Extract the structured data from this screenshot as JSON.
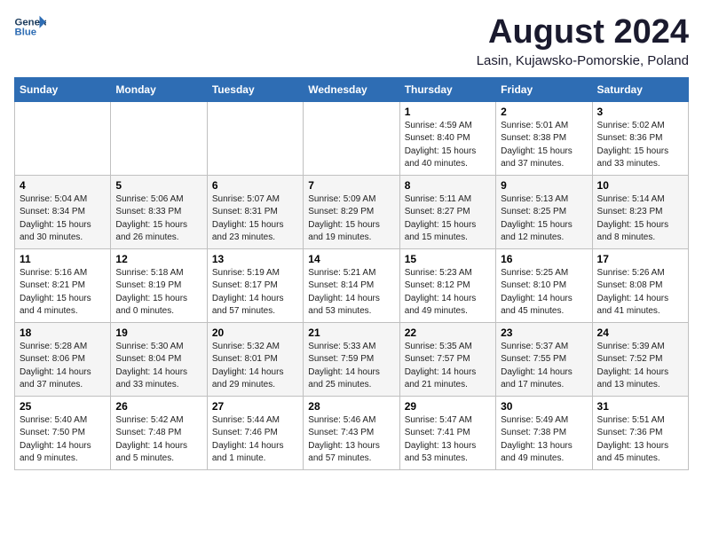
{
  "logo": {
    "line1": "General",
    "line2": "Blue"
  },
  "title": "August 2024",
  "location": "Lasin, Kujawsko-Pomorskie, Poland",
  "days_of_week": [
    "Sunday",
    "Monday",
    "Tuesday",
    "Wednesday",
    "Thursday",
    "Friday",
    "Saturday"
  ],
  "weeks": [
    [
      {
        "num": "",
        "info": ""
      },
      {
        "num": "",
        "info": ""
      },
      {
        "num": "",
        "info": ""
      },
      {
        "num": "",
        "info": ""
      },
      {
        "num": "1",
        "info": "Sunrise: 4:59 AM\nSunset: 8:40 PM\nDaylight: 15 hours\nand 40 minutes."
      },
      {
        "num": "2",
        "info": "Sunrise: 5:01 AM\nSunset: 8:38 PM\nDaylight: 15 hours\nand 37 minutes."
      },
      {
        "num": "3",
        "info": "Sunrise: 5:02 AM\nSunset: 8:36 PM\nDaylight: 15 hours\nand 33 minutes."
      }
    ],
    [
      {
        "num": "4",
        "info": "Sunrise: 5:04 AM\nSunset: 8:34 PM\nDaylight: 15 hours\nand 30 minutes."
      },
      {
        "num": "5",
        "info": "Sunrise: 5:06 AM\nSunset: 8:33 PM\nDaylight: 15 hours\nand 26 minutes."
      },
      {
        "num": "6",
        "info": "Sunrise: 5:07 AM\nSunset: 8:31 PM\nDaylight: 15 hours\nand 23 minutes."
      },
      {
        "num": "7",
        "info": "Sunrise: 5:09 AM\nSunset: 8:29 PM\nDaylight: 15 hours\nand 19 minutes."
      },
      {
        "num": "8",
        "info": "Sunrise: 5:11 AM\nSunset: 8:27 PM\nDaylight: 15 hours\nand 15 minutes."
      },
      {
        "num": "9",
        "info": "Sunrise: 5:13 AM\nSunset: 8:25 PM\nDaylight: 15 hours\nand 12 minutes."
      },
      {
        "num": "10",
        "info": "Sunrise: 5:14 AM\nSunset: 8:23 PM\nDaylight: 15 hours\nand 8 minutes."
      }
    ],
    [
      {
        "num": "11",
        "info": "Sunrise: 5:16 AM\nSunset: 8:21 PM\nDaylight: 15 hours\nand 4 minutes."
      },
      {
        "num": "12",
        "info": "Sunrise: 5:18 AM\nSunset: 8:19 PM\nDaylight: 15 hours\nand 0 minutes."
      },
      {
        "num": "13",
        "info": "Sunrise: 5:19 AM\nSunset: 8:17 PM\nDaylight: 14 hours\nand 57 minutes."
      },
      {
        "num": "14",
        "info": "Sunrise: 5:21 AM\nSunset: 8:14 PM\nDaylight: 14 hours\nand 53 minutes."
      },
      {
        "num": "15",
        "info": "Sunrise: 5:23 AM\nSunset: 8:12 PM\nDaylight: 14 hours\nand 49 minutes."
      },
      {
        "num": "16",
        "info": "Sunrise: 5:25 AM\nSunset: 8:10 PM\nDaylight: 14 hours\nand 45 minutes."
      },
      {
        "num": "17",
        "info": "Sunrise: 5:26 AM\nSunset: 8:08 PM\nDaylight: 14 hours\nand 41 minutes."
      }
    ],
    [
      {
        "num": "18",
        "info": "Sunrise: 5:28 AM\nSunset: 8:06 PM\nDaylight: 14 hours\nand 37 minutes."
      },
      {
        "num": "19",
        "info": "Sunrise: 5:30 AM\nSunset: 8:04 PM\nDaylight: 14 hours\nand 33 minutes."
      },
      {
        "num": "20",
        "info": "Sunrise: 5:32 AM\nSunset: 8:01 PM\nDaylight: 14 hours\nand 29 minutes."
      },
      {
        "num": "21",
        "info": "Sunrise: 5:33 AM\nSunset: 7:59 PM\nDaylight: 14 hours\nand 25 minutes."
      },
      {
        "num": "22",
        "info": "Sunrise: 5:35 AM\nSunset: 7:57 PM\nDaylight: 14 hours\nand 21 minutes."
      },
      {
        "num": "23",
        "info": "Sunrise: 5:37 AM\nSunset: 7:55 PM\nDaylight: 14 hours\nand 17 minutes."
      },
      {
        "num": "24",
        "info": "Sunrise: 5:39 AM\nSunset: 7:52 PM\nDaylight: 14 hours\nand 13 minutes."
      }
    ],
    [
      {
        "num": "25",
        "info": "Sunrise: 5:40 AM\nSunset: 7:50 PM\nDaylight: 14 hours\nand 9 minutes."
      },
      {
        "num": "26",
        "info": "Sunrise: 5:42 AM\nSunset: 7:48 PM\nDaylight: 14 hours\nand 5 minutes."
      },
      {
        "num": "27",
        "info": "Sunrise: 5:44 AM\nSunset: 7:46 PM\nDaylight: 14 hours\nand 1 minute."
      },
      {
        "num": "28",
        "info": "Sunrise: 5:46 AM\nSunset: 7:43 PM\nDaylight: 13 hours\nand 57 minutes."
      },
      {
        "num": "29",
        "info": "Sunrise: 5:47 AM\nSunset: 7:41 PM\nDaylight: 13 hours\nand 53 minutes."
      },
      {
        "num": "30",
        "info": "Sunrise: 5:49 AM\nSunset: 7:38 PM\nDaylight: 13 hours\nand 49 minutes."
      },
      {
        "num": "31",
        "info": "Sunrise: 5:51 AM\nSunset: 7:36 PM\nDaylight: 13 hours\nand 45 minutes."
      }
    ]
  ]
}
